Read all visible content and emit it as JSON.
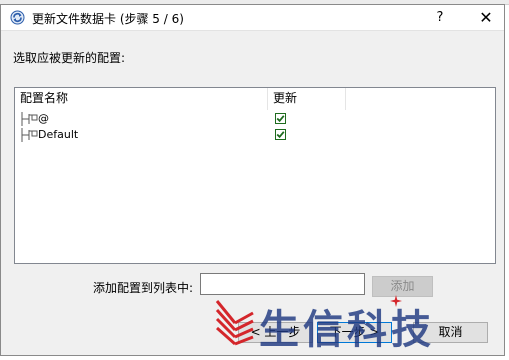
{
  "window": {
    "title": "更新文件数据卡 (步骤 5 / 6)",
    "help_glyph": "?",
    "close_glyph": "✕"
  },
  "prompt": "选取应被更新的配置:",
  "list": {
    "columns": [
      "配置名称",
      "更新"
    ],
    "rows": [
      {
        "name": "@",
        "checked": true
      },
      {
        "name": "Default",
        "checked": true
      }
    ]
  },
  "add_row": {
    "label": "添加配置到列表中:",
    "input_value": "",
    "button_label": "添加"
  },
  "buttons": {
    "prev": "< 上一步",
    "next": "下一步 >",
    "cancel": "取消"
  },
  "watermark": {
    "text": "生信科技"
  },
  "colors": {
    "check_green": "#1e6b1e",
    "watermark_red": "#d4262b",
    "watermark_blue": "#1f3880"
  }
}
